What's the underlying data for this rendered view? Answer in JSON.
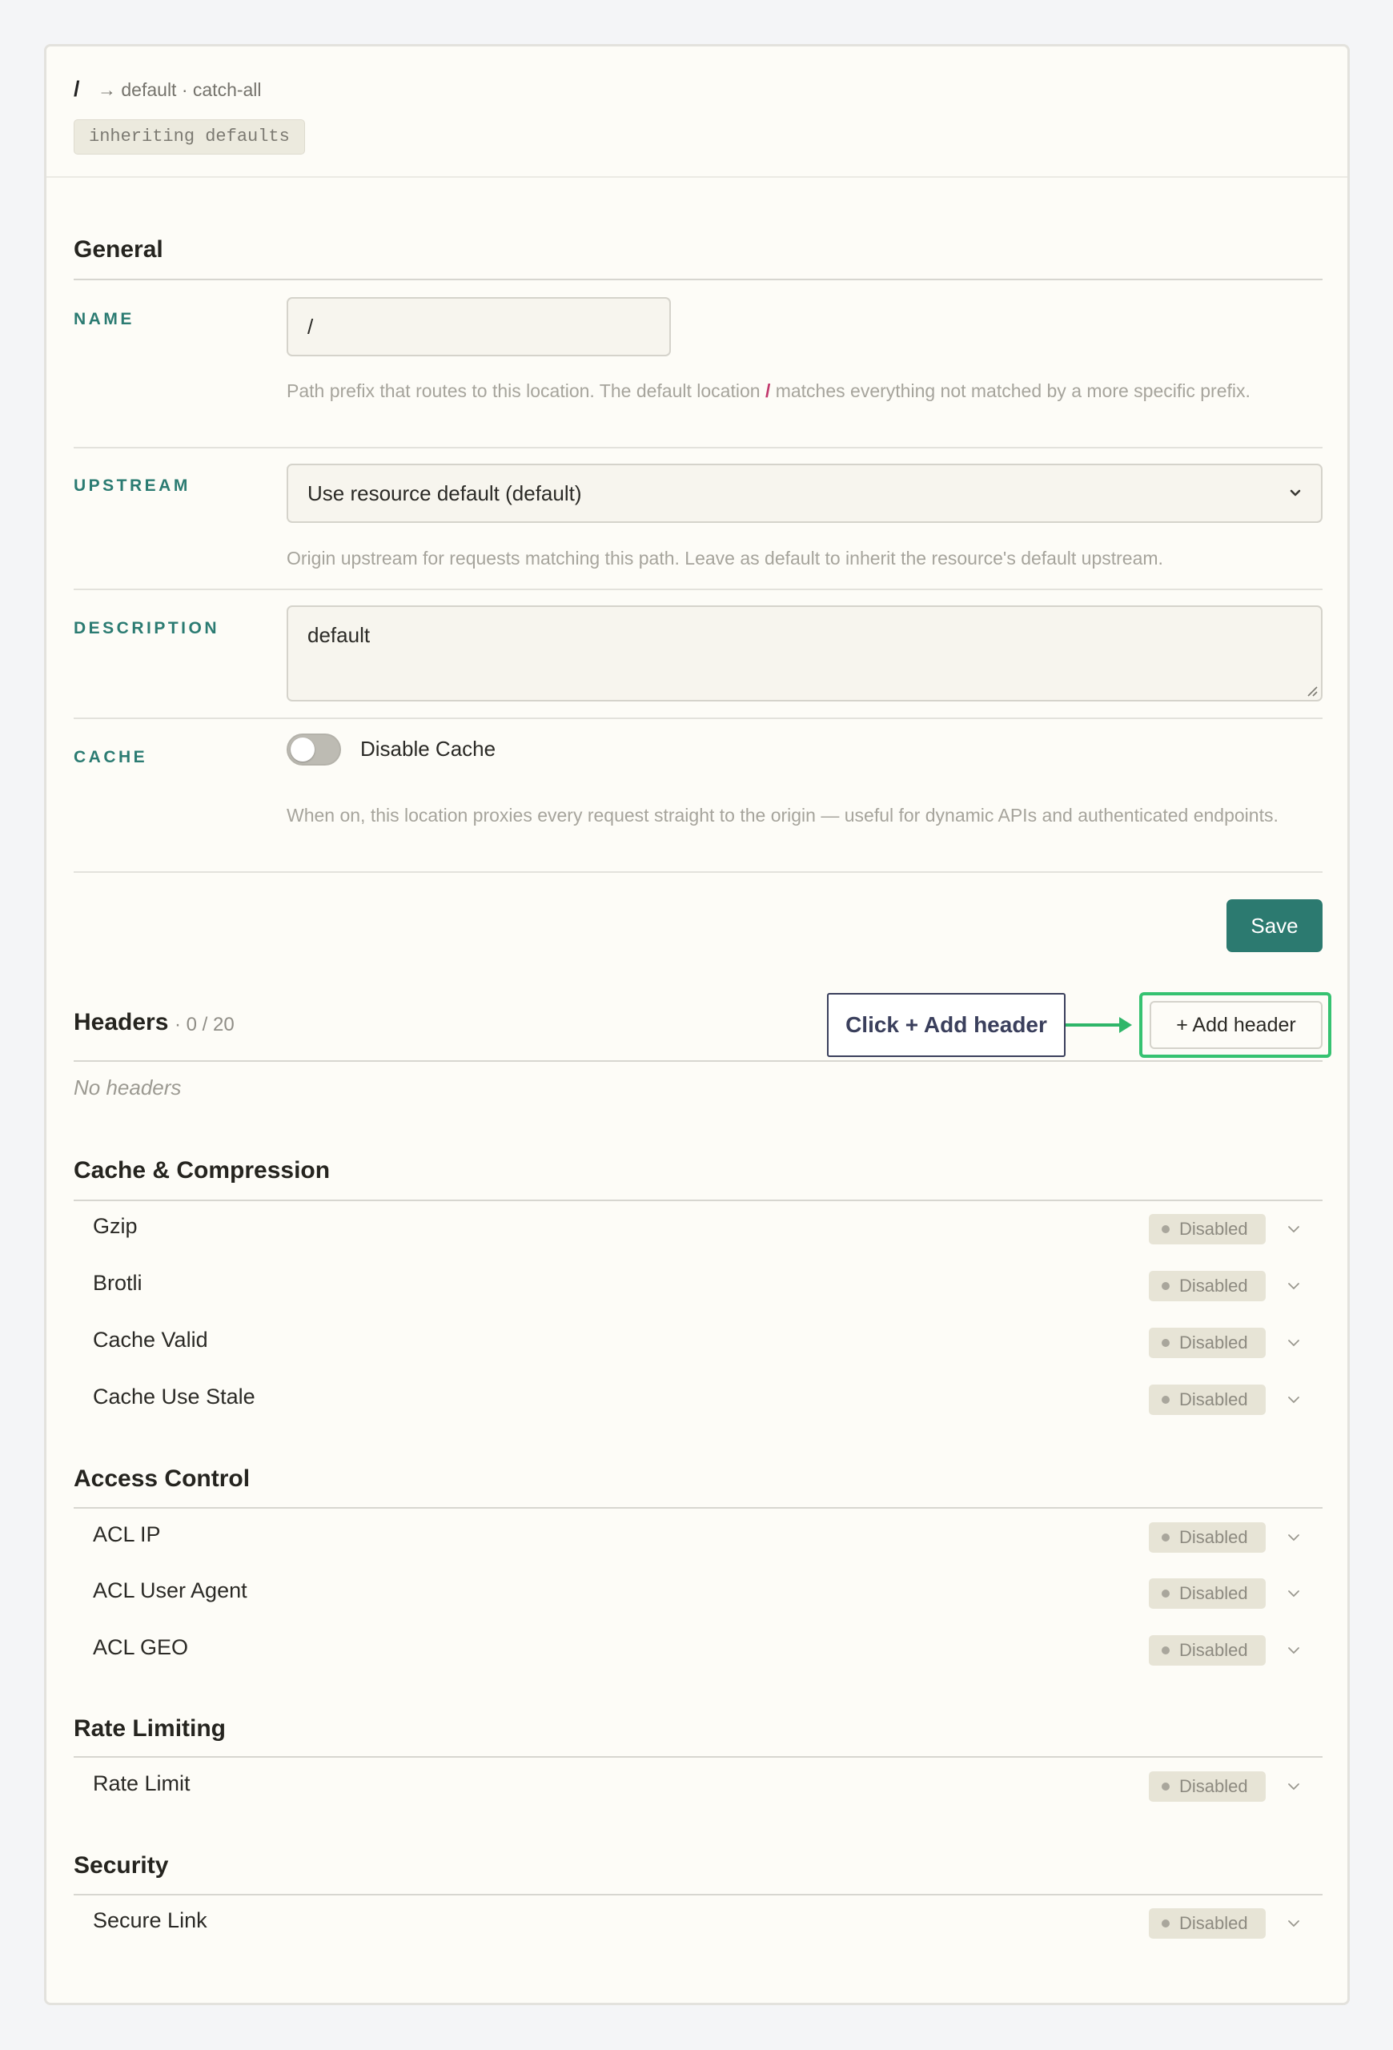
{
  "breadcrumb": {
    "path": "/",
    "target": "→ default · catch-all",
    "chip": "inheriting defaults"
  },
  "general": {
    "title": "General",
    "name_label": "NAME",
    "name_value": "/",
    "name_help_before": "Path prefix that routes to this location. The default location ",
    "name_help_code": "/",
    "name_help_after": " matches everything not matched by a more specific prefix.",
    "upstream_label": "UPSTREAM",
    "upstream_value": "Use resource default (default)",
    "upstream_help": "Origin upstream for requests matching this path. Leave as default to inherit the resource's default upstream.",
    "description_label": "DESCRIPTION",
    "description_value": "default",
    "cache_label": "CACHE",
    "cache_toggle_label": "Disable Cache",
    "cache_toggle_on": false,
    "cache_help": "When on, this location proxies every request straight to the origin — useful for dynamic APIs and authenticated endpoints.",
    "save_label": "Save"
  },
  "headers": {
    "title": "Headers",
    "count": "· 0 / 20",
    "add_label": "+ Add header",
    "empty": "No headers",
    "callout": "Click + Add header"
  },
  "sections": [
    {
      "title": "Cache & Compression",
      "items": [
        {
          "name": "Gzip",
          "status": "Disabled"
        },
        {
          "name": "Brotli",
          "status": "Disabled"
        },
        {
          "name": "Cache Valid",
          "status": "Disabled"
        },
        {
          "name": "Cache Use Stale",
          "status": "Disabled"
        }
      ]
    },
    {
      "title": "Access Control",
      "items": [
        {
          "name": "ACL IP",
          "status": "Disabled"
        },
        {
          "name": "ACL User Agent",
          "status": "Disabled"
        },
        {
          "name": "ACL GEO",
          "status": "Disabled"
        }
      ]
    },
    {
      "title": "Rate Limiting",
      "items": [
        {
          "name": "Rate Limit",
          "status": "Disabled"
        }
      ]
    },
    {
      "title": "Security",
      "items": [
        {
          "name": "Secure Link",
          "status": "Disabled"
        }
      ]
    }
  ],
  "colors": {
    "accent": "#2c7a70",
    "label": "#2b7b72",
    "highlight": "#36c271",
    "badge_bg": "#e7e4d6"
  },
  "icons": {
    "select": "chevron-down-icon",
    "row": "chevron-down-icon",
    "status": "dot-icon"
  }
}
